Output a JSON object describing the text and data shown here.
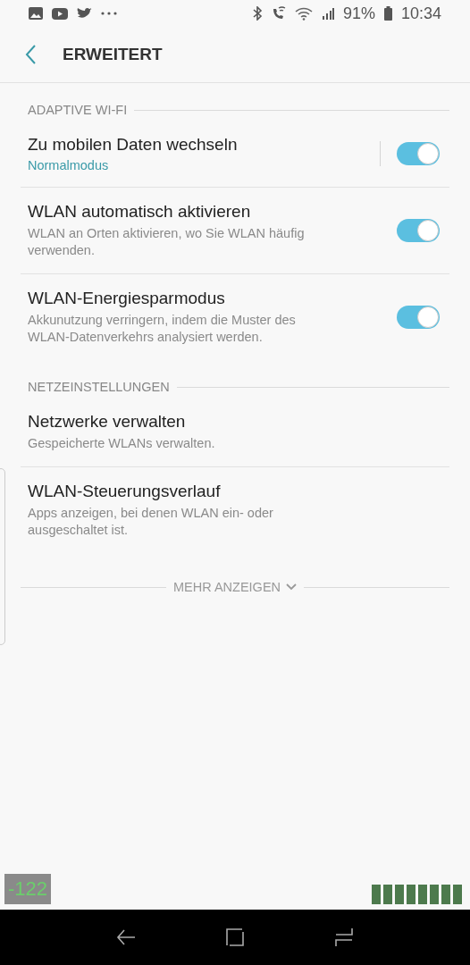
{
  "status_bar": {
    "battery": "91%",
    "time": "10:34"
  },
  "header": {
    "title": "ERWEITERT"
  },
  "sections": [
    {
      "title": "ADAPTIVE WI-FI",
      "items": [
        {
          "kind": "split-toggle",
          "title": "Zu mobilen Daten wechseln",
          "summary": "Normalmodus",
          "on": true
        },
        {
          "kind": "toggle",
          "title": "WLAN automatisch aktivieren",
          "description": "WLAN an Orten aktivieren, wo Sie WLAN häufig verwenden.",
          "on": true
        },
        {
          "kind": "toggle",
          "title": "WLAN-Energiesparmodus",
          "description": "Akkunutzung verringern, indem die Muster des WLAN-Datenverkehrs analysiert werden.",
          "on": true
        }
      ]
    },
    {
      "title": "NETZEINSTELLUNGEN",
      "items": [
        {
          "kind": "link",
          "title": "Netzwerke verwalten",
          "description": "Gespeicherte WLANs verwalten."
        },
        {
          "kind": "link",
          "title": "WLAN-Steuerungsverlauf",
          "description": "Apps anzeigen, bei denen WLAN ein- oder ausgeschaltet ist."
        }
      ]
    }
  ],
  "more_button": "MEHR ANZEIGEN",
  "overlay": {
    "reading": "-122"
  }
}
